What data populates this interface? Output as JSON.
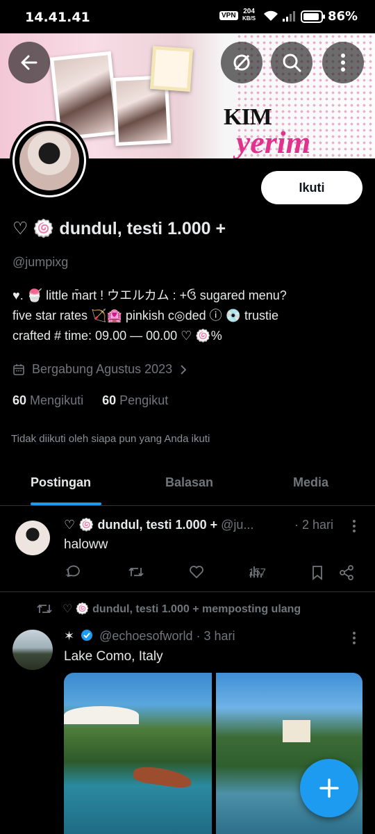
{
  "status_bar": {
    "time": "14.41.41",
    "vpn": "VPN",
    "speed_value": "204",
    "speed_unit": "KB/S",
    "battery": "86%"
  },
  "banner": {
    "title_line1": "KIM",
    "title_line2": "yerim",
    "accent_color": "#e0338e"
  },
  "header_buttons": {
    "back": "back-arrow-icon",
    "grok": "grok-icon",
    "search": "search-icon",
    "more": "more-vertical-icon"
  },
  "profile": {
    "follow_label": "Ikuti",
    "display_name": "♡ 🍥 dundul, testi 1.000 +",
    "handle": "@jumpixg",
    "bio_line1": "♥. 🍧 little m̄art !  ウエルカム : +ઉ sugared menu?",
    "bio_line2": "five star rates 🏹🏩 pinkish c◎ded ⓘ 💿 trustie",
    "bio_line3": "crafted # time: 09.00 — 00.00 ♡ 🍥%",
    "joined": "Bergabung Agustus 2023",
    "following_count": "60",
    "following_label": "Mengikuti",
    "followers_count": "60",
    "followers_label": "Pengikut",
    "not_followed_note": "Tidak diikuti oleh siapa pun yang Anda ikuti"
  },
  "tabs": [
    {
      "label": "Postingan",
      "active": true
    },
    {
      "label": "Balasan",
      "active": false
    },
    {
      "label": "Media",
      "active": false
    }
  ],
  "posts": [
    {
      "author": "♡ 🍥 dundul, testi 1.000 +",
      "handle": "@ju...",
      "time": "· 2 hari",
      "text": "haloww",
      "replies": "1",
      "views": "157"
    }
  ],
  "repost": {
    "reposter_line": "♡ 🍥 dundul, testi 1.000 + memposting ulang",
    "author_symbol": "✶",
    "handle": "@echoesofworld",
    "time": "· 3 hari",
    "text": "Lake Como, Italy"
  },
  "fab": {
    "icon": "plus-icon"
  },
  "colors": {
    "link_blue": "#1d9bf0",
    "muted": "#71767b",
    "border": "#2f3336"
  }
}
